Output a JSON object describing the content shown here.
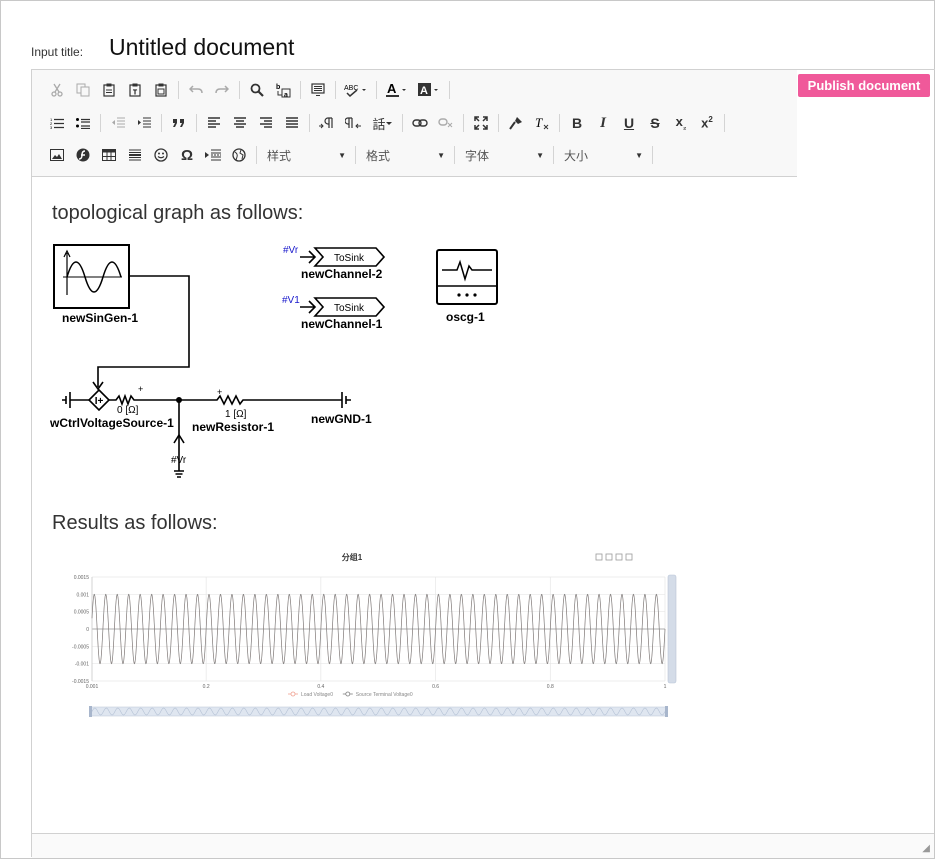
{
  "header": {
    "title_label": "Input title:",
    "title_value": "Untitled document",
    "publish_label": "Publish document"
  },
  "toolbar": {
    "combos": {
      "style": "样式",
      "format": "格式",
      "font": "字体",
      "size": "大小"
    },
    "row1_icons": [
      "cut-icon",
      "copy-icon",
      "paste-icon",
      "paste-text-icon",
      "paste-word-icon",
      "undo-icon",
      "redo-icon",
      "find-icon",
      "replace-icon",
      "select-all-icon",
      "spellcheck-icon",
      "text-color-icon",
      "bg-color-icon"
    ],
    "row2_icons": [
      "numbered-list-icon",
      "bulleted-list-icon",
      "outdent-icon",
      "indent-icon",
      "blockquote-icon",
      "align-left-icon",
      "align-center-icon",
      "align-right-icon",
      "justify-icon",
      "ltr-icon",
      "rtl-icon",
      "language-icon",
      "link-icon",
      "unlink-icon",
      "maximize-icon",
      "copy-format-icon",
      "remove-format-icon",
      "bold-icon",
      "italic-icon",
      "underline-icon",
      "strike-icon",
      "subscript-icon",
      "superscript-icon"
    ],
    "row3_icons": [
      "image-icon",
      "flash-icon",
      "table-icon",
      "hr-icon",
      "smiley-icon",
      "special-char-icon",
      "page-break-icon",
      "iframe-icon"
    ]
  },
  "content": {
    "heading1": "topological graph as follows:",
    "heading2": "Results as follows:",
    "diagram": {
      "sin_gen": "newSinGen-1",
      "vsource": "wCtrlVoltageSource-1",
      "vsource_res": "0 [Ω]",
      "resistor": "newResistor-1",
      "resistor_val": "1 [Ω]",
      "gnd": "newGND-1",
      "probe_label": "#Vr",
      "channel2_in": "#Vr",
      "channel2_block": "ToSink",
      "channel2_name": "newChannel-2",
      "channel1_in": "#V1",
      "channel1_block": "ToSink",
      "channel1_name": "newChannel-1",
      "scope": "oscg-1",
      "plus": "+"
    }
  },
  "chart_data": {
    "type": "line",
    "title": "分组1",
    "x": [
      0.001,
      1
    ],
    "xticks": [
      "0.001",
      "0.2",
      "0.4",
      "0.6",
      "0.8",
      "1"
    ],
    "yticks": [
      "0.0015",
      "0.001",
      "0.0005",
      "0",
      "-0.0005",
      "-0.001",
      "-0.0015"
    ],
    "ylim": [
      -0.0015,
      0.0015
    ],
    "cycles": 50,
    "amplitude": 0.001,
    "series": [
      {
        "name": "Load Voltage0",
        "color": "#f0a090"
      },
      {
        "name": "Source Terminal Voltage0",
        "color": "#7f7f7f"
      }
    ],
    "legend": "bottom",
    "grid": true,
    "toolbox_icons": [
      "zoom-icon",
      "zoom-reset-icon",
      "restore-icon",
      "save-image-icon"
    ]
  }
}
